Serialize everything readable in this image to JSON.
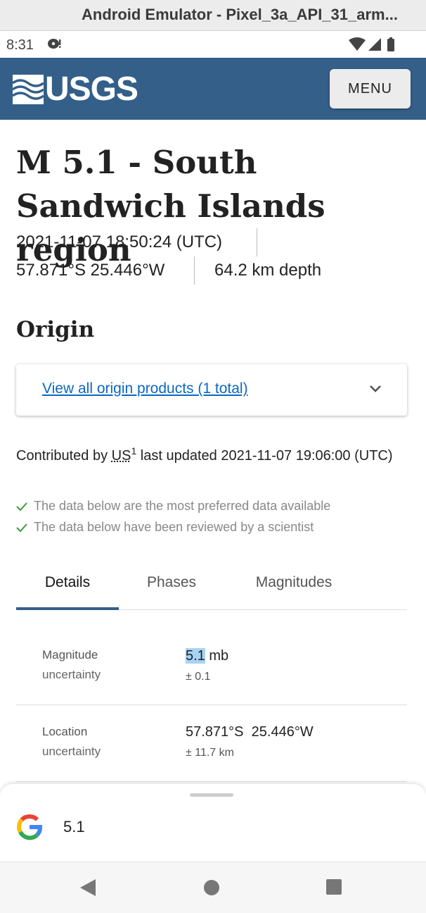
{
  "window": {
    "title": "Android Emulator - Pixel_3a_API_31_arm..."
  },
  "status_bar": {
    "time": "8:31",
    "icons": [
      "notification-icon",
      "wifi-icon",
      "signal-icon",
      "battery-icon"
    ]
  },
  "header": {
    "logo_text": "USGS",
    "menu_label": "MENU",
    "color": "#335f89"
  },
  "event": {
    "title": "M 5.1 - South Sandwich Islands region",
    "datetime": "2021-11-07 18:50:24 (UTC)",
    "coords": "57.871°S 25.446°W",
    "depth": "64.2 km depth"
  },
  "origin": {
    "heading": "Origin",
    "view_link": "View all origin products (1 total)",
    "contributed_prefix": "Contributed by",
    "contributor": "US",
    "contributor_sup": "1",
    "updated": "last updated 2021-11-07 19:06:00 (UTC)",
    "checks": [
      "The data below are the most preferred data available",
      "The data below have been reviewed by a scientist"
    ]
  },
  "tabs": [
    {
      "label": "Details",
      "active": true
    },
    {
      "label": "Phases",
      "active": false
    },
    {
      "label": "Magnitudes",
      "active": false
    }
  ],
  "details": {
    "magnitude": {
      "label": "Magnitude",
      "sub": "uncertainty",
      "value": "5.1",
      "unit": "mb",
      "uncertainty": "± 0.1"
    },
    "location": {
      "label": "Location",
      "sub": "uncertainty",
      "lat": "57.871°S",
      "lon": "25.446°W",
      "uncertainty": "± 11.7 km"
    }
  },
  "search_sheet": {
    "query": "5.1"
  },
  "nav": [
    "back-icon",
    "home-icon",
    "recents-icon"
  ]
}
